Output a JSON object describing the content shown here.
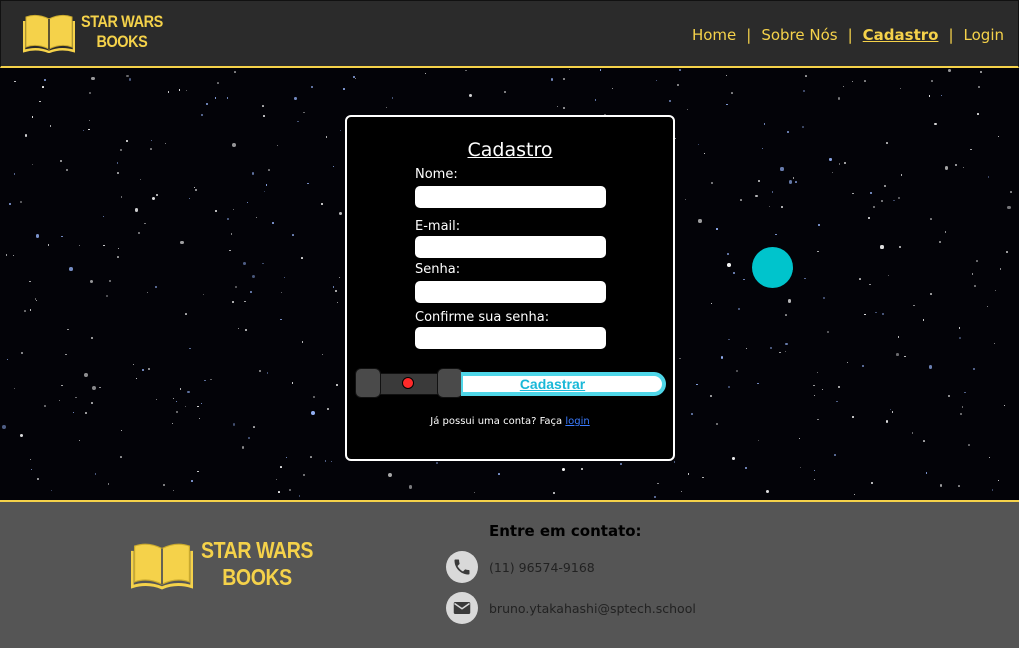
{
  "brand": {
    "line1": "STAR WARS",
    "line2": "BOOKS"
  },
  "nav": {
    "items": [
      {
        "label": "Home"
      },
      {
        "label": "Sobre Nós"
      },
      {
        "label": "Cadastro"
      },
      {
        "label": "Login"
      }
    ],
    "separator": "|",
    "active": "Cadastro"
  },
  "form": {
    "title": "Cadastro",
    "fields": [
      {
        "label": "Nome:",
        "value": ""
      },
      {
        "label": "E-mail:",
        "value": ""
      },
      {
        "label": "Senha:",
        "value": ""
      },
      {
        "label": "Confirme sua senha:",
        "value": ""
      }
    ],
    "submit_label": "Cadastrar",
    "login_prompt": "Já possui uma conta? Faça",
    "login_link": "login"
  },
  "footer": {
    "contact_title": "Entre em contato:",
    "phone": "(11) 96574-9168",
    "email": "bruno.ytakahashi@sptech.school"
  },
  "colors": {
    "accent": "#f5d24a",
    "planet": "#00c4cc",
    "saber_glow": "#4fd6e8",
    "link": "#3a7bff"
  },
  "icons": {
    "logo": "open-book-icon",
    "phone": "phone-icon",
    "email": "envelope-icon"
  }
}
